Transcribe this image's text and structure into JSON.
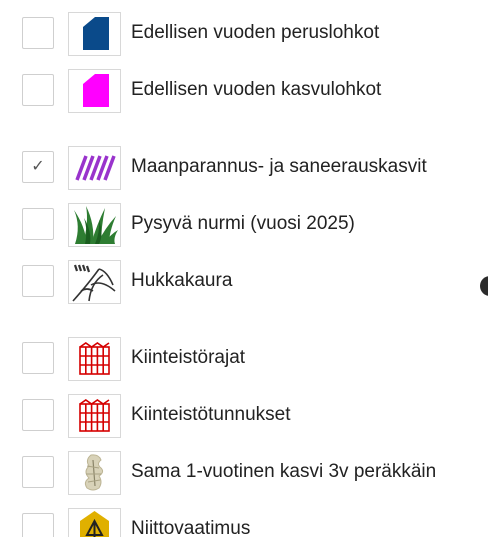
{
  "layers": [
    {
      "label": "Edellisen vuoden peruslohkot",
      "checked": false,
      "icon": "previous-year-parcel-icon",
      "color": "#0a4a8a"
    },
    {
      "label": "Edellisen vuoden kasvulohkot",
      "checked": false,
      "icon": "previous-year-growth-parcel-icon",
      "color": "#ff00ff"
    },
    {
      "label": "Maanparannus- ja saneerauskasvit",
      "checked": true,
      "icon": "diagonal-hatch-icon",
      "color": "#9933cc"
    },
    {
      "label": "Pysyvä nurmi (vuosi 2025)",
      "checked": false,
      "icon": "grass-icon",
      "color": "#2e7d32"
    },
    {
      "label": "Hukkakaura",
      "checked": false,
      "icon": "wild-oat-icon"
    },
    {
      "label": "Kiinteistörajat",
      "checked": false,
      "icon": "property-boundary-icon",
      "color": "#d50000"
    },
    {
      "label": "Kiinteistötunnukset",
      "checked": false,
      "icon": "property-id-icon",
      "color": "#d50000"
    },
    {
      "label": "Sama 1-vuotinen kasvi 3v peräkkäin",
      "checked": false,
      "icon": "same-crop-icon"
    },
    {
      "label": "Niittovaatimus",
      "checked": false,
      "icon": "mowing-requirement-icon",
      "color": "#e0b000"
    }
  ],
  "check_mark": "✓"
}
